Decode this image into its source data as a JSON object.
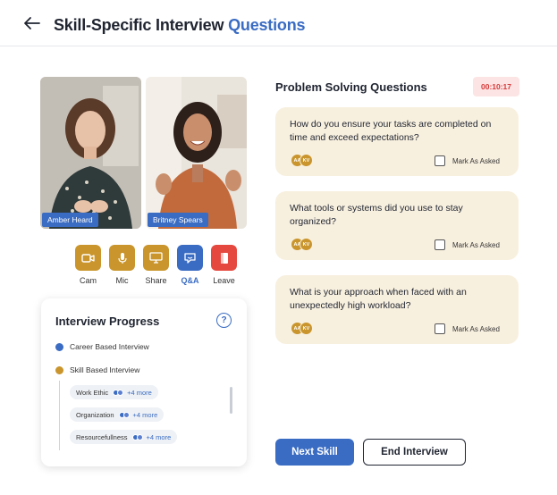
{
  "header": {
    "back_icon": "arrow-left-icon",
    "title_main": "Skill-Specific Interview",
    "title_accent": "Questions"
  },
  "participants": [
    {
      "name": "Amber Heard"
    },
    {
      "name": "Britney Spears"
    }
  ],
  "controls": [
    {
      "label": "Cam",
      "icon": "camera-icon",
      "color": "#c9952c"
    },
    {
      "label": "Mic",
      "icon": "mic-icon",
      "color": "#c9952c"
    },
    {
      "label": "Share",
      "icon": "screen-share-icon",
      "color": "#c9952c"
    },
    {
      "label": "Q&A",
      "icon": "chat-icon",
      "color": "#3a6cc3"
    },
    {
      "label": "Leave",
      "icon": "leave-icon",
      "color": "#e5483f"
    }
  ],
  "progress": {
    "title": "Interview Progress",
    "help_icon": "?",
    "steps": [
      {
        "label": "Career Based Interview",
        "color": "#3a6cc3"
      },
      {
        "label": "Skill Based Interview",
        "color": "#c9952c"
      }
    ],
    "sub_items": [
      {
        "label": "Work Ethic",
        "more": "+4 more"
      },
      {
        "label": "Organization",
        "more": "+4 more"
      },
      {
        "label": "Resourcefullness",
        "more": "+4 more"
      }
    ]
  },
  "questions_panel": {
    "title": "Problem Solving Questions",
    "timer": "00:10:17",
    "mark_label": "Mark As Asked",
    "questions": [
      {
        "text": "How do you ensure your tasks are completed on time and exceed expectations?",
        "avatars": [
          "AA",
          "KV"
        ]
      },
      {
        "text": "What tools or systems did you use to stay organized?",
        "avatars": [
          "AA",
          "KV"
        ]
      },
      {
        "text": "What is your approach when faced with an unexpectedly high workload?",
        "avatars": [
          "AA",
          "KV"
        ]
      }
    ]
  },
  "actions": {
    "next": "Next Skill",
    "end": "End Interview"
  },
  "colors": {
    "accent": "#3a6cc3",
    "gold": "#c9952c",
    "danger": "#e5483f",
    "card_bg": "#f8f0df"
  }
}
